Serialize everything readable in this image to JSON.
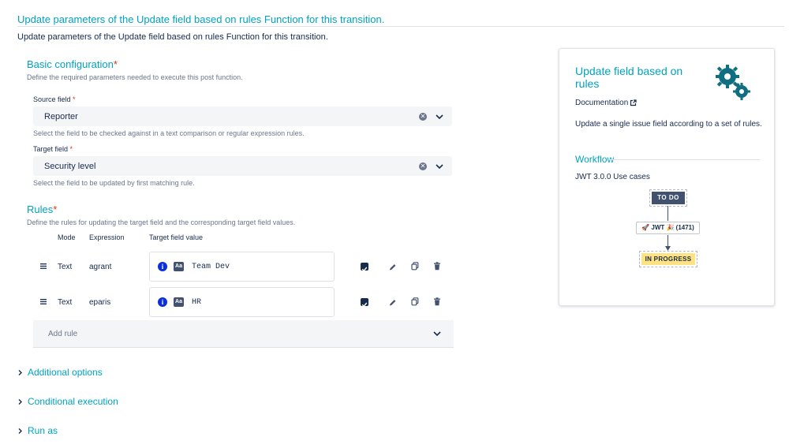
{
  "header": {
    "title": "Update parameters of the Update field based on rules Function for this transition.",
    "description": "Update parameters of the Update field based on rules Function for this transition."
  },
  "basic": {
    "title": "Basic configuration",
    "required_mark": "*",
    "description": "Define the required parameters needed to execute this post function.",
    "source_field": {
      "label": "Source field",
      "required_mark": "*",
      "value": "Reporter",
      "help": "Select the field to be checked against in a text comparison or regular expression rules."
    },
    "target_field": {
      "label": "Target field",
      "required_mark": "*",
      "value": "Security level",
      "help": "Select the field to be updated by first matching rule."
    }
  },
  "rules": {
    "title": "Rules",
    "required_mark": "*",
    "description": "Define the rules for updating the target field and the corresponding target field values.",
    "columns": {
      "mode": "Mode",
      "expression": "Expression",
      "target_value": "Target field value"
    },
    "rows": [
      {
        "mode": "Text",
        "expression": "agrant",
        "type_icon": "Aa",
        "value": "Team Dev"
      },
      {
        "mode": "Text",
        "expression": "eparis",
        "type_icon": "Aa",
        "value": "HR"
      }
    ],
    "add_rule_label": "Add rule"
  },
  "sections": {
    "additional_options": "Additional options",
    "conditional_execution": "Conditional execution",
    "run_as": "Run as"
  },
  "panel": {
    "title": "Update field based on rules",
    "documentation_label": "Documentation",
    "description": "Update a single issue field according to a set of rules.",
    "workflow_title": "Workflow",
    "workflow_subtitle": "JWT 3.0.0 Use cases",
    "status_from": "TO DO",
    "transition_label": "🚀 JWT 🎉 (1471)",
    "status_to": "IN PROGRESS"
  },
  "colors": {
    "accent": "#00a3bf",
    "required": "#de350b",
    "status_todo_bg": "#42526e",
    "status_progress_bg": "#ffe380"
  }
}
